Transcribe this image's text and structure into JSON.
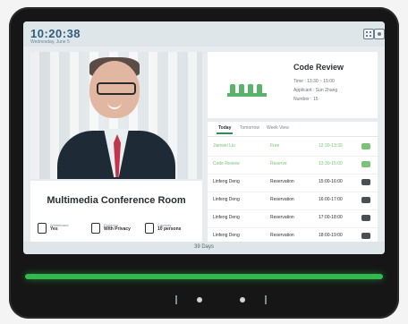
{
  "status_bar": {
    "time": "10:20:38",
    "subtitle": "Wednesday, June 5",
    "icons": [
      "grid-icon",
      "settings-icon"
    ]
  },
  "room": {
    "name": "Multimedia Conference Room",
    "facilities": [
      {
        "label": "Whiteboard",
        "value": "Yes",
        "icon": "person-icon"
      },
      {
        "label": "Projector",
        "value": "With Privacy",
        "icon": "shield-icon"
      },
      {
        "label": "Capacity",
        "value": "10 persons",
        "icon": "seat-icon"
      }
    ]
  },
  "meeting": {
    "title": "Code Review",
    "time": "Time : 13:30 ~ 15:00",
    "applicant": "Applicant : Sun Zhang",
    "number": "Number : 15"
  },
  "schedule": {
    "tabs": [
      "Today",
      "Tomorrow",
      "Week View"
    ],
    "rows": [
      {
        "name": "Jianwei Liu",
        "state": "Free",
        "time": "12:30-13:30",
        "highlight": true
      },
      {
        "name": "Code Review",
        "state": "Reserve",
        "time": "13:30-15:00",
        "highlight": true
      },
      {
        "name": "Linfeng Deng",
        "state": "Reservation",
        "time": "15:00-16:00",
        "highlight": false
      },
      {
        "name": "Linfeng Deng",
        "state": "Reservation",
        "time": "16:00-17:00",
        "highlight": false
      },
      {
        "name": "Linfeng Deng",
        "state": "Reservation",
        "time": "17:00-18:00",
        "highlight": false
      },
      {
        "name": "Linfeng Deng",
        "state": "Reservation",
        "time": "18:00-19:00",
        "highlight": false
      }
    ]
  },
  "footer": {
    "label": "39 Days"
  },
  "colors": {
    "accent_green": "#31b94e",
    "title_blue": "#2f5d7c"
  }
}
